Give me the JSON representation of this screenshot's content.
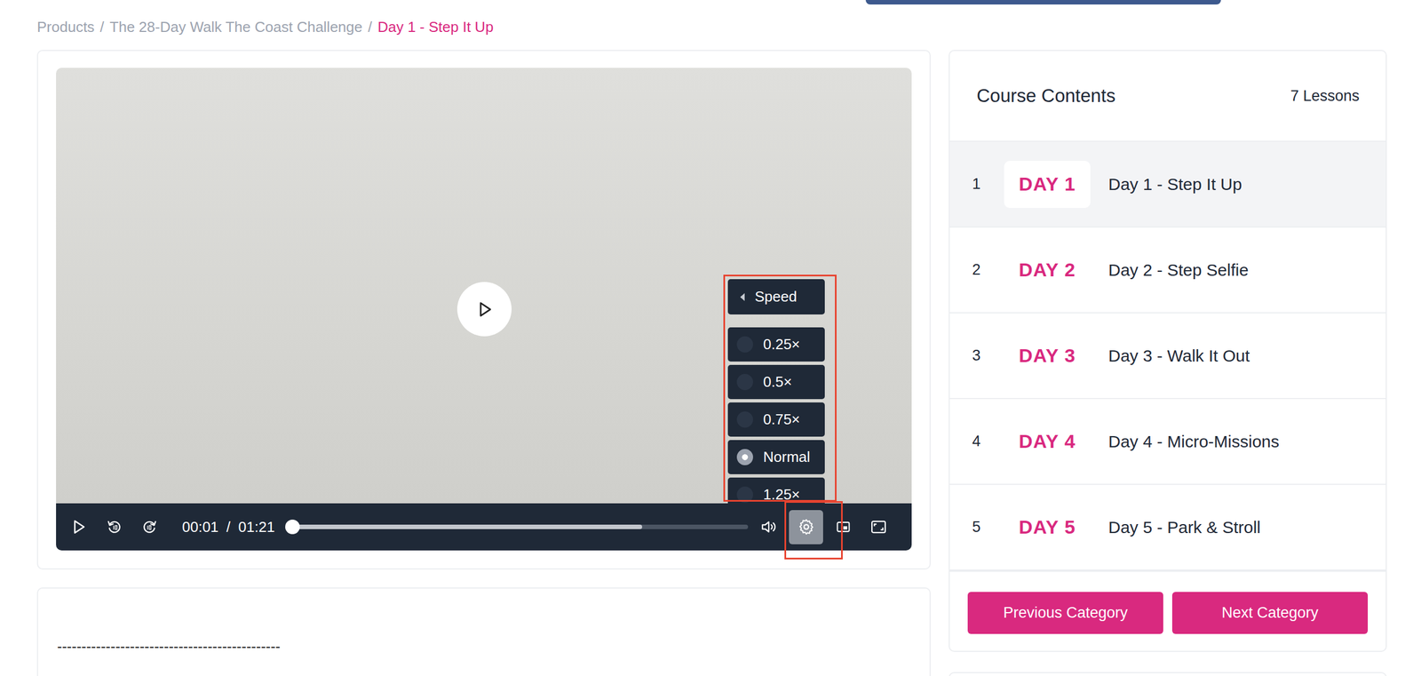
{
  "breadcrumb": [
    {
      "label": "Products",
      "current": false
    },
    {
      "label": "The 28-Day Walk The Coast Challenge",
      "current": false
    },
    {
      "label": "Day 1 - Step It Up",
      "current": true
    }
  ],
  "breadcrumb_separator": "/",
  "player": {
    "current_time": "00:01",
    "time_separator": "/",
    "duration": "01:21",
    "level": 0.0123,
    "buffered": 0.77,
    "playing": false,
    "settings_open": true,
    "settings_annotated": true
  },
  "speed_menu": {
    "title": "Speed",
    "annotated": true,
    "options": [
      {
        "label": "0.25×",
        "selected": false
      },
      {
        "label": "0.5×",
        "selected": false
      },
      {
        "label": "0.75×",
        "selected": false
      },
      {
        "label": "Normal",
        "selected": true
      },
      {
        "label": "1.25×",
        "selected": false
      }
    ]
  },
  "course": {
    "title": "Course Contents",
    "count": "7 Lessons",
    "lessons": [
      {
        "number": "1",
        "badge": "DAY 1",
        "title": "Day 1 - Step It Up",
        "selected": true
      },
      {
        "number": "2",
        "badge": "DAY 2",
        "title": "Day 2 - Step Selfie",
        "selected": false
      },
      {
        "number": "3",
        "badge": "DAY 3",
        "title": "Day 3 - Walk It Out",
        "selected": false
      },
      {
        "number": "4",
        "badge": "DAY 4",
        "title": "Day 4 - Micro-Missions",
        "selected": false
      },
      {
        "number": "5",
        "badge": "DAY 5",
        "title": "Day 5 - Park & Stroll",
        "selected": false
      }
    ]
  },
  "buttons": [
    "Previous Category",
    "Next Category"
  ],
  "description": {
    "text": "----------------------------------------------"
  }
}
